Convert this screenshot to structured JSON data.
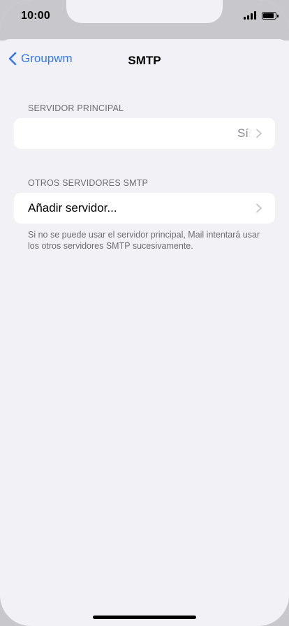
{
  "status_bar": {
    "time": "10:00",
    "icons": [
      "signal-icon",
      "battery-icon"
    ]
  },
  "nav": {
    "back_label": "Groupwm",
    "title": "SMTP",
    "back_icon": "chevron-left-icon"
  },
  "primary_server": {
    "header": "SERVIDOR PRINCIPAL",
    "value": "Sí"
  },
  "other_servers": {
    "header": "OTROS SERVIDORES SMTP",
    "add_label": "Añadir servidor...",
    "footnote": "Si no se puede usar el servidor principal, Mail intentará usar los otros servidores SMTP sucesivamente."
  },
  "colors": {
    "accent": "#3478f6",
    "background": "#f1f1f6",
    "cell": "#ffffff",
    "secondary_text": "#6d6d72"
  }
}
